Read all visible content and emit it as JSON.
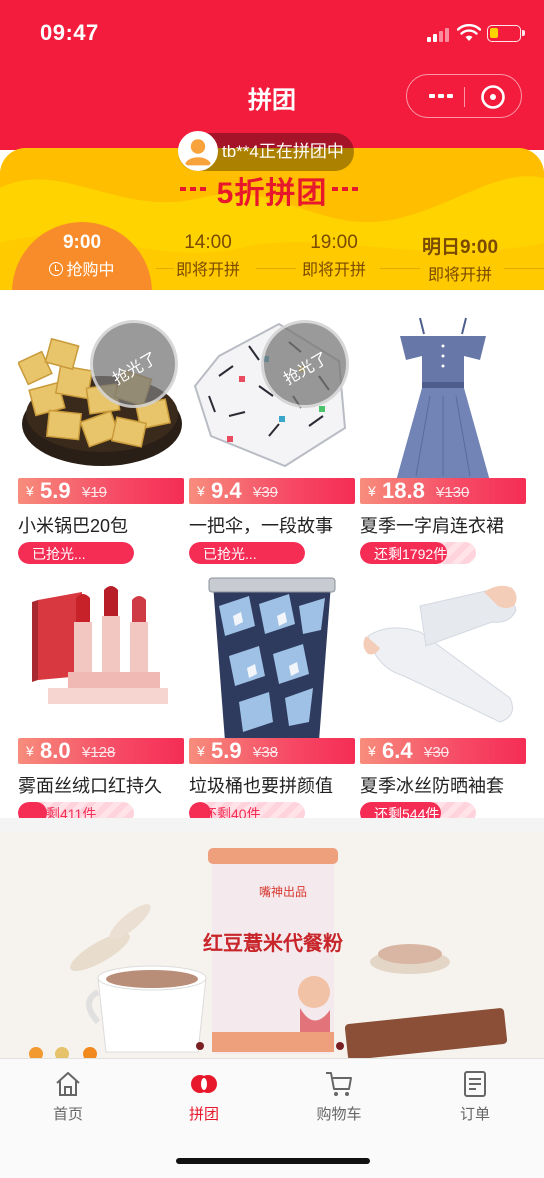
{
  "status_bar": {
    "time": "09:47"
  },
  "nav": {
    "title": "拼团"
  },
  "banner": {
    "ticker": "tb**4正在拼团中",
    "title": "5折拼团",
    "tabs": [
      {
        "time": "9:00",
        "status": "抢购中",
        "active": true
      },
      {
        "time": "14:00",
        "status": "即将开拼",
        "active": false
      },
      {
        "time": "19:00",
        "status": "即将开拼",
        "active": false
      },
      {
        "time": "明日9:00",
        "status": "即将开拼",
        "active": false
      }
    ]
  },
  "products": [
    {
      "name": "小米锅巴20包",
      "price": "5.9",
      "original_price": "19",
      "stock_label": "已抢光...",
      "stock_fill_fraction": 1.0,
      "sold_out": true,
      "sold_out_label": "抢光了",
      "icon": "snack-image"
    },
    {
      "name": "一把伞，一段故事",
      "price": "9.4",
      "original_price": "39",
      "stock_label": "已抢光...",
      "stock_fill_fraction": 1.0,
      "sold_out": true,
      "sold_out_label": "抢光了",
      "icon": "umbrella-image"
    },
    {
      "name": "夏季一字肩连衣裙",
      "price": "18.8",
      "original_price": "130",
      "stock_label": "还剩1792件",
      "stock_fill_fraction": 0.75,
      "sold_out": false,
      "icon": "dress-image"
    },
    {
      "name": "雾面丝绒口红持久",
      "price": "8.0",
      "original_price": "128",
      "stock_label": "还剩411件",
      "stock_fill_fraction": 0.25,
      "sold_out": false,
      "icon": "lipstick-image"
    },
    {
      "name": "垃圾桶也要拼颜值",
      "price": "5.9",
      "original_price": "38",
      "stock_label": "还剩40件",
      "stock_fill_fraction": 0.1,
      "sold_out": false,
      "icon": "trash-can-image"
    },
    {
      "name": "夏季冰丝防晒袖套",
      "price": "6.4",
      "original_price": "30",
      "stock_label": "还剩544件",
      "stock_fill_fraction": 0.7,
      "sold_out": false,
      "icon": "arm-sleeve-image"
    }
  ],
  "currency_symbol": "¥",
  "promo": {
    "brand_text": "嘴神出品",
    "product_text": "红豆薏米代餐粉",
    "icon": "promo-banner-image"
  },
  "tabbar": [
    {
      "label": "首页",
      "icon": "home-icon",
      "active": false
    },
    {
      "label": "拼团",
      "icon": "group-buy-icon",
      "active": true
    },
    {
      "label": "购物车",
      "icon": "cart-icon",
      "active": false
    },
    {
      "label": "订单",
      "icon": "order-icon",
      "active": false
    }
  ],
  "colors": {
    "primary": "#f31c3c",
    "banner": "#ffd300",
    "accent": "#f98c2a"
  }
}
